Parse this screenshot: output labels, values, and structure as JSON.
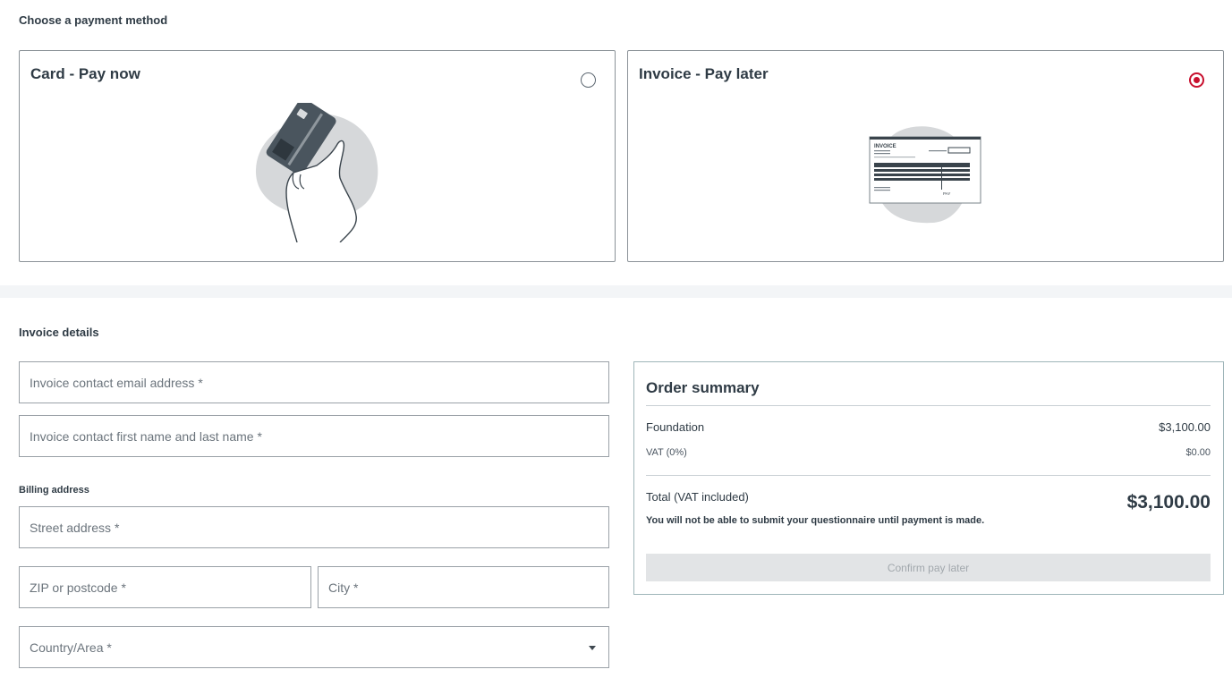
{
  "payment": {
    "heading": "Choose a payment method",
    "options": [
      {
        "title": "Card - Pay now",
        "selected": false,
        "icon": "credit-card-hand-illustration"
      },
      {
        "title": "Invoice - Pay later",
        "selected": true,
        "icon": "invoice-document-illustration"
      }
    ],
    "invoice_doc_title": "INVOICE",
    "invoice_doc_pay": "PAY",
    "accent_color": "#c8102e"
  },
  "invoice_details": {
    "heading": "Invoice details",
    "email_placeholder": "Invoice contact email address *",
    "name_placeholder": "Invoice contact first name and last name *",
    "billing_label": "Billing address",
    "street_placeholder": "Street address *",
    "zip_placeholder": "ZIP or postcode *",
    "city_placeholder": "City *",
    "country_placeholder": "Country/Area *"
  },
  "summary": {
    "title": "Order summary",
    "item_label": "Foundation",
    "item_amount": "$3,100.00",
    "vat_label": "VAT (0%)",
    "vat_amount": "$0.00",
    "total_label": "Total (VAT included)",
    "total_amount": "$3,100.00",
    "note": "You will not be able to submit your questionnaire until payment is made.",
    "confirm_label": "Confirm pay later"
  }
}
